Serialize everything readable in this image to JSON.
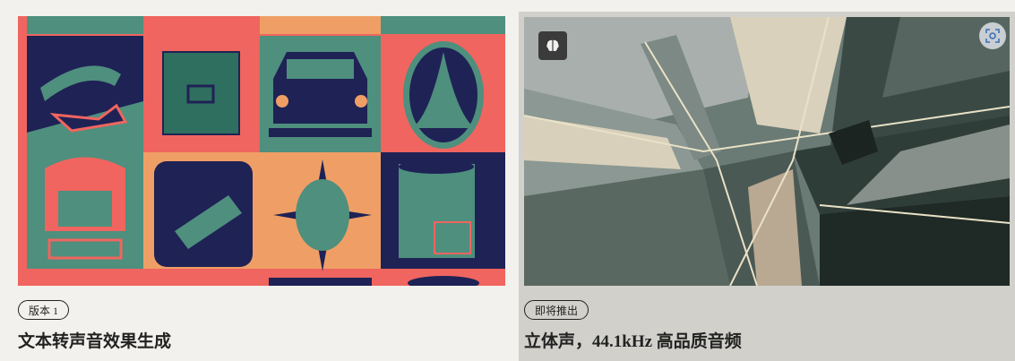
{
  "cards": [
    {
      "badge": "版本 1",
      "title": "文本转声音效果生成",
      "image_alt": "poster-grid"
    },
    {
      "badge": "即将推出",
      "title": "立体声，44.1kHz 高品质音频",
      "image_alt": "abstract-architecture"
    }
  ],
  "icons": {
    "brain": "brain-icon",
    "scan": "scan-icon"
  },
  "colors": {
    "page_bg": "#f2f1ed",
    "card_right_bg": "#d1d0cb",
    "poster_red": "#f0655f",
    "poster_navy": "#1f2255",
    "poster_teal": "#4e8f7e",
    "poster_orange": "#ef9f66"
  }
}
